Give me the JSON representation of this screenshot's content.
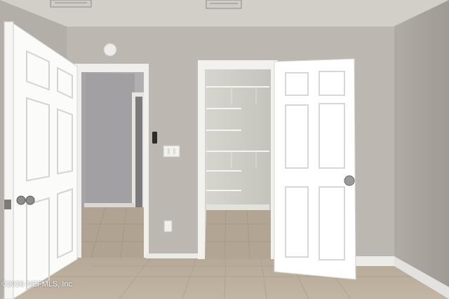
{
  "photo": {
    "watermark": "©2026 NEFMLS, Inc",
    "colors": {
      "ceiling": "#d3d0ca",
      "wall": "#bdb8b1",
      "right_wall": "#aaa59f",
      "floor_tile": "#b8ab9a",
      "door_white": "#ffffff",
      "trim": "#f2f1ee",
      "closet_wall": "#cfcfc8",
      "hall_wall": "#a9a6a8"
    }
  }
}
